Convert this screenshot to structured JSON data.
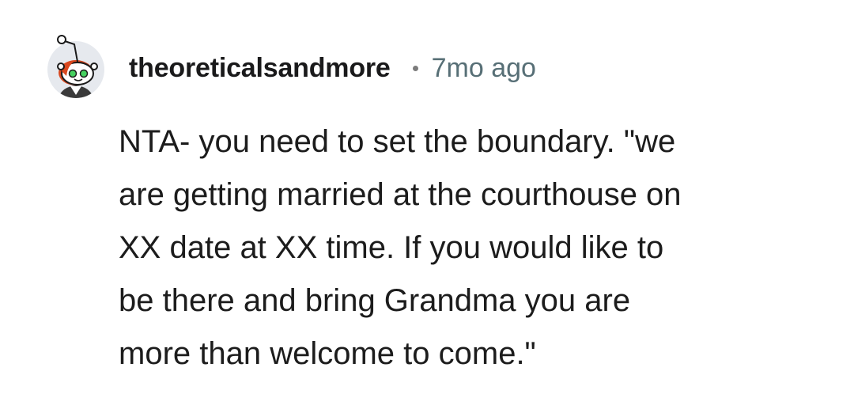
{
  "comment": {
    "author": "theoreticalsandmore",
    "timestamp": "7mo ago",
    "avatar_icon": "snoo-avatar-icon",
    "body_lines": [
      "NTA- you need to set the boundary. \"we",
      "are getting married at the courthouse on",
      "XX date at XX time. If you would like to",
      "be there and bring Grandma you are",
      "more than welcome to come.\""
    ]
  },
  "colors": {
    "author": "#1a1a1b",
    "meta": "#576f76",
    "text": "#1c1c1c",
    "background": "#ffffff"
  }
}
